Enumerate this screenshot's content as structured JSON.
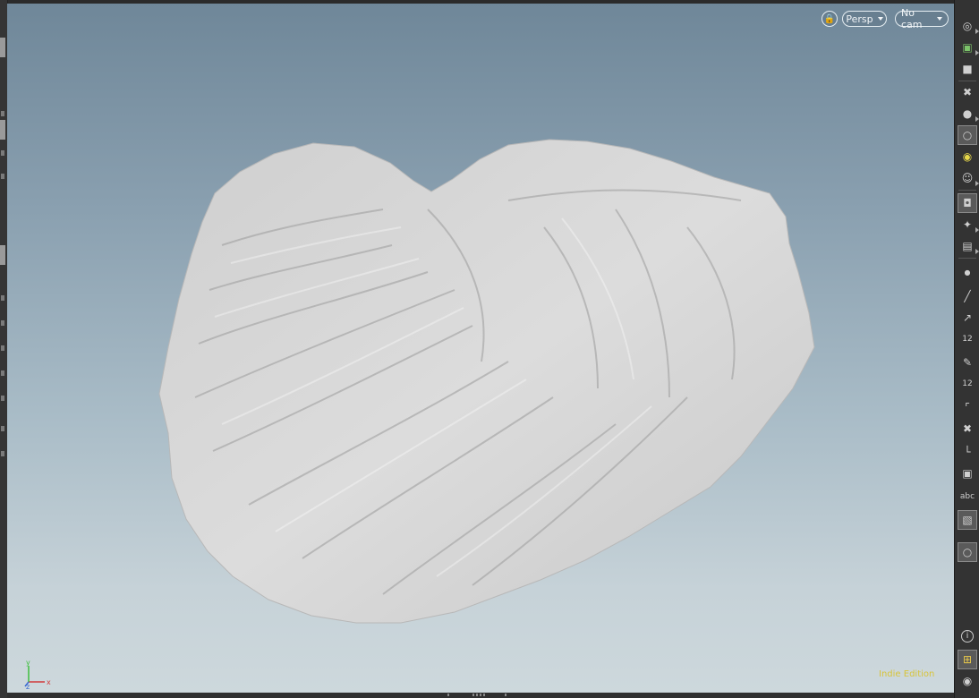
{
  "viewport": {
    "projection_label": "Persp",
    "camera_label": "No cam",
    "edition_label": "Indie Edition",
    "axis": {
      "x_label": "x",
      "y_label": "y",
      "z_label": "z"
    },
    "bg_top": "#6f8799",
    "bg_bottom": "#cdd8dc",
    "mesh_color": "#d6d6d6"
  },
  "right_toolbar": {
    "items": [
      {
        "icon": "eye-visibility-icon"
      },
      {
        "icon": "view-camera-icon"
      },
      {
        "icon": "lock-icon"
      },
      {
        "icon": "bulb-off-icon"
      },
      {
        "icon": "shaded-sphere-icon"
      },
      {
        "icon": "light-icon",
        "active": true
      },
      {
        "icon": "light-yellow-icon"
      },
      {
        "icon": "light-ghost-icon"
      },
      {
        "icon": "display-object-icon",
        "active": true
      },
      {
        "icon": "template-icon"
      },
      {
        "icon": "point-display-icon"
      },
      {
        "icon": "dot-icon"
      },
      {
        "icon": "normal-icon"
      },
      {
        "icon": "vertex-normal-icon"
      },
      {
        "icon": "point-number-icon",
        "text": "12"
      },
      {
        "icon": "brush-icon"
      },
      {
        "icon": "prim-number-icon",
        "text": "12"
      },
      {
        "icon": "corner-icon"
      },
      {
        "icon": "shrink-icon"
      },
      {
        "icon": "axis-handle-icon"
      },
      {
        "icon": "stop-icon"
      },
      {
        "icon": "text-abc-icon",
        "text": "abc"
      },
      {
        "icon": "background-image-icon",
        "active": true
      },
      {
        "icon": "bulb-icon",
        "active": true
      },
      {
        "icon": "info-icon",
        "text": "i"
      },
      {
        "icon": "grid-layout-icon",
        "active": true
      },
      {
        "icon": "eye-icon"
      }
    ]
  }
}
